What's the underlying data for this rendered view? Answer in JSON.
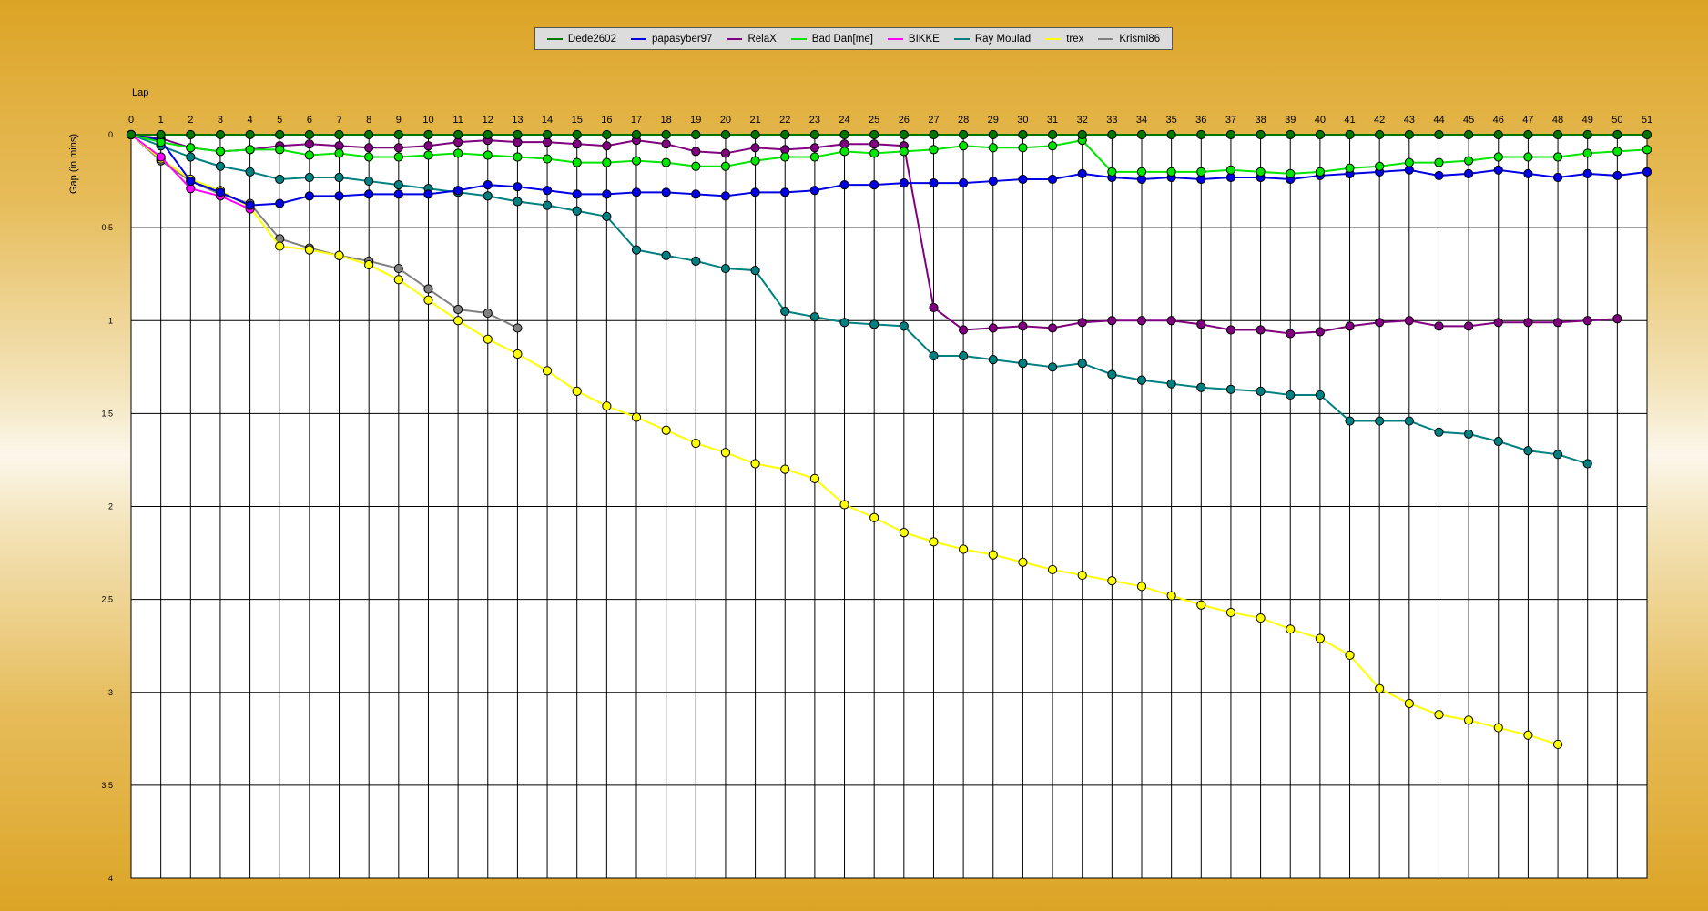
{
  "chart_data": {
    "type": "line",
    "xlabel": "Lap",
    "ylabel": "Gap (in mins)",
    "x": [
      0,
      1,
      2,
      3,
      4,
      5,
      6,
      7,
      8,
      9,
      10,
      11,
      12,
      13,
      14,
      15,
      16,
      17,
      18,
      19,
      20,
      21,
      22,
      23,
      24,
      25,
      26,
      27,
      28,
      29,
      30,
      31,
      32,
      33,
      34,
      35,
      36,
      37,
      38,
      39,
      40,
      41,
      42,
      43,
      44,
      45,
      46,
      47,
      48,
      49,
      50,
      51
    ],
    "xlim": [
      0,
      51
    ],
    "ylim": [
      0,
      4
    ],
    "y_inverted": true,
    "yticks": [
      0,
      0.5,
      1,
      1.5,
      2,
      2.5,
      3,
      3.5,
      4
    ],
    "ytick_labels": [
      "0",
      "0.5",
      "1",
      "1.5",
      "2",
      "2.5",
      "3",
      "3.5",
      "4"
    ],
    "grid": true,
    "legend_position": "top",
    "series": [
      {
        "name": "Dede2602",
        "color": "#007800",
        "values": [
          0,
          0,
          0,
          0,
          0,
          0,
          0,
          0,
          0,
          0,
          0,
          0,
          0,
          0,
          0,
          0,
          0,
          0,
          0,
          0,
          0,
          0,
          0,
          0,
          0,
          0,
          0,
          0,
          0,
          0,
          0,
          0,
          0,
          0,
          0,
          0,
          0,
          0,
          0,
          0,
          0,
          0,
          0,
          0,
          0,
          0,
          0,
          0,
          0,
          0,
          0,
          0
        ]
      },
      {
        "name": "papasyber97",
        "color": "#0000e6",
        "values": [
          0,
          0.03,
          0.25,
          0.31,
          0.38,
          0.37,
          0.33,
          0.33,
          0.32,
          0.32,
          0.32,
          0.3,
          0.27,
          0.28,
          0.3,
          0.32,
          0.32,
          0.31,
          0.31,
          0.32,
          0.33,
          0.31,
          0.31,
          0.3,
          0.27,
          0.27,
          0.26,
          0.26,
          0.26,
          0.25,
          0.24,
          0.24,
          0.21,
          0.23,
          0.24,
          0.23,
          0.24,
          0.23,
          0.23,
          0.24,
          0.22,
          0.21,
          0.2,
          0.19,
          0.22,
          0.21,
          0.19,
          0.21,
          0.23,
          0.21,
          0.22,
          0.2
        ]
      },
      {
        "name": "RelaX",
        "color": "#800080",
        "values": [
          0,
          0.02,
          0.07,
          0.09,
          0.08,
          0.06,
          0.05,
          0.06,
          0.07,
          0.07,
          0.06,
          0.04,
          0.03,
          0.04,
          0.04,
          0.05,
          0.06,
          0.03,
          0.05,
          0.09,
          0.1,
          0.07,
          0.08,
          0.07,
          0.05,
          0.05,
          0.06,
          0.93,
          1.05,
          1.04,
          1.03,
          1.04,
          1.01,
          1.0,
          1.0,
          1.0,
          1.02,
          1.05,
          1.05,
          1.07,
          1.06,
          1.03,
          1.01,
          1.0,
          1.03,
          1.03,
          1.01,
          1.01,
          1.01,
          1.0,
          0.99,
          null
        ]
      },
      {
        "name": "Bad Dan[me]",
        "color": "#00e600",
        "values": [
          0,
          0.04,
          0.07,
          0.09,
          0.08,
          0.08,
          0.11,
          0.1,
          0.12,
          0.12,
          0.11,
          0.1,
          0.11,
          0.12,
          0.13,
          0.15,
          0.15,
          0.14,
          0.15,
          0.17,
          0.17,
          0.14,
          0.12,
          0.12,
          0.09,
          0.1,
          0.09,
          0.08,
          0.06,
          0.07,
          0.07,
          0.06,
          0.03,
          0.2,
          0.2,
          0.2,
          0.2,
          0.19,
          0.2,
          0.21,
          0.2,
          0.18,
          0.17,
          0.15,
          0.15,
          0.14,
          0.12,
          0.12,
          0.12,
          0.1,
          0.09,
          0.08
        ]
      },
      {
        "name": "BIKKE",
        "color": "#ff00ff",
        "values": [
          0,
          0.12,
          0.29,
          0.33,
          0.4,
          null,
          null,
          null,
          null,
          null,
          null,
          null,
          null,
          null,
          null,
          null,
          null,
          null,
          null,
          null,
          null,
          null,
          null,
          null,
          null,
          null,
          null,
          null,
          null,
          null,
          null,
          null,
          null,
          null,
          null,
          null,
          null,
          null,
          null,
          null,
          null,
          null,
          null,
          null,
          null,
          null,
          null,
          null,
          null,
          null,
          null,
          null
        ]
      },
      {
        "name": "Ray Moulad",
        "color": "#008080",
        "values": [
          0,
          0.06,
          0.12,
          0.17,
          0.2,
          0.24,
          0.23,
          0.23,
          0.25,
          0.27,
          0.29,
          0.31,
          0.33,
          0.36,
          0.38,
          0.41,
          0.44,
          0.62,
          0.65,
          0.68,
          0.72,
          0.73,
          0.95,
          0.98,
          1.01,
          1.02,
          1.03,
          1.19,
          1.19,
          1.21,
          1.23,
          1.25,
          1.23,
          1.29,
          1.32,
          1.34,
          1.36,
          1.37,
          1.38,
          1.4,
          1.4,
          1.54,
          1.54,
          1.54,
          1.6,
          1.61,
          1.65,
          1.7,
          1.72,
          1.77,
          null,
          null
        ]
      },
      {
        "name": "trex",
        "color": "#ffff00",
        "values": [
          0,
          0.13,
          0.24,
          0.3,
          0.39,
          0.6,
          0.62,
          0.65,
          0.7,
          0.78,
          0.89,
          1.0,
          1.1,
          1.18,
          1.27,
          1.38,
          1.46,
          1.52,
          1.59,
          1.66,
          1.71,
          1.77,
          1.8,
          1.85,
          1.99,
          2.06,
          2.14,
          2.19,
          2.23,
          2.26,
          2.3,
          2.34,
          2.37,
          2.4,
          2.43,
          2.48,
          2.53,
          2.57,
          2.6,
          2.66,
          2.71,
          2.8,
          2.98,
          3.06,
          3.12,
          3.15,
          3.19,
          3.23,
          3.28,
          null,
          null,
          null
        ]
      },
      {
        "name": "Krismi86",
        "color": "#808080",
        "values": [
          0,
          0.14,
          0.25,
          0.32,
          0.37,
          0.56,
          0.61,
          0.65,
          0.68,
          0.72,
          0.83,
          0.94,
          0.96,
          1.04,
          null,
          null,
          null,
          null,
          null,
          null,
          null,
          null,
          null,
          null,
          null,
          null,
          null,
          null,
          null,
          null,
          null,
          null,
          null,
          null,
          null,
          null,
          null,
          null,
          null,
          null,
          null,
          null,
          null,
          null,
          null,
          null,
          null,
          null,
          null,
          null,
          null,
          null
        ]
      }
    ]
  }
}
